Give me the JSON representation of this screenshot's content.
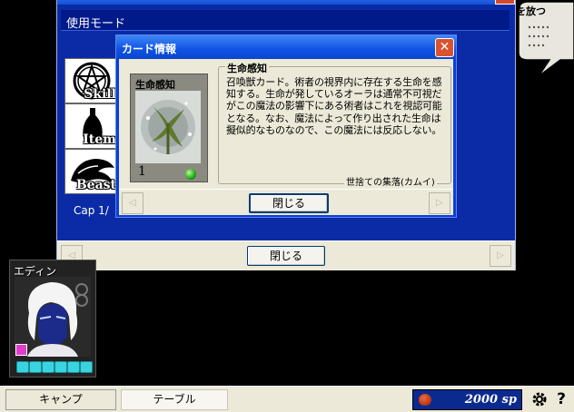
{
  "outer_window": {
    "mode_label": "使用モード",
    "tabs": [
      {
        "label": "Skill"
      },
      {
        "label": "Item"
      },
      {
        "label": "Beast"
      }
    ],
    "capacity": "Cap 1/",
    "close_label": "閉じる"
  },
  "card_dialog": {
    "title": "カード情報",
    "close_icon": "✕",
    "card": {
      "name": "生命感知",
      "level": "1"
    },
    "desc_title": "生命感知",
    "description": "召喚獣カード。術者の視界内に存在する生命を感知する。生命が発しているオーラは通常不可視だがこの魔法の影響下にある術者はこれを視認可能となる。なお、魔法によって作り出された生命は擬似的なものなので、この魔法には反応しない。",
    "source": "世捨ての集落(カムイ)",
    "close_label": "閉じる",
    "prev_arrow": "◁",
    "next_arrow": "▷"
  },
  "bubble": {
    "text": "を放つ"
  },
  "character": {
    "name": "エディン",
    "hp_cells": 6
  },
  "statusbar": {
    "camp_label": "キャンプ",
    "table_label": "テーブル",
    "money": "2000 sp",
    "settings_icon": "gear-icon",
    "help_icon": "?"
  },
  "colors": {
    "window_blue": "#0a2ba5",
    "dialog_blue": "#0b3fd8",
    "panel": "#ece9d8",
    "close_red": "#d9532e"
  }
}
